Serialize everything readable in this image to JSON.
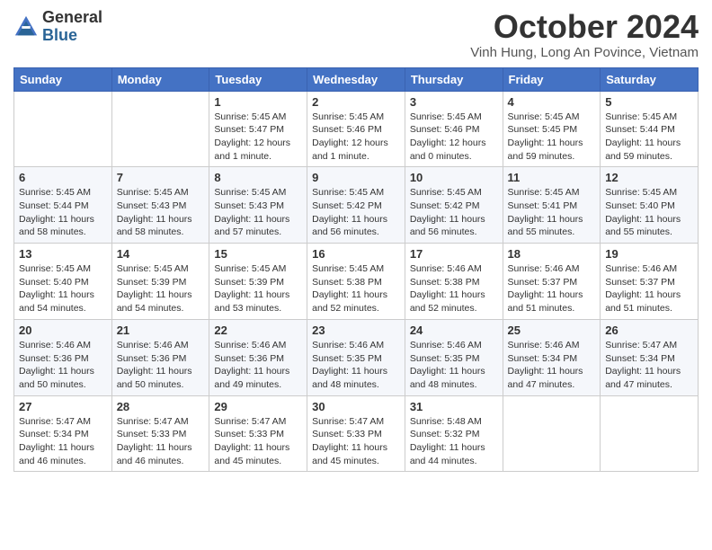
{
  "logo": {
    "general": "General",
    "blue": "Blue"
  },
  "header": {
    "month": "October 2024",
    "location": "Vinh Hung, Long An Povince, Vietnam"
  },
  "days_of_week": [
    "Sunday",
    "Monday",
    "Tuesday",
    "Wednesday",
    "Thursday",
    "Friday",
    "Saturday"
  ],
  "weeks": [
    [
      {
        "day": "",
        "info": ""
      },
      {
        "day": "",
        "info": ""
      },
      {
        "day": "1",
        "info": "Sunrise: 5:45 AM\nSunset: 5:47 PM\nDaylight: 12 hours and 1 minute."
      },
      {
        "day": "2",
        "info": "Sunrise: 5:45 AM\nSunset: 5:46 PM\nDaylight: 12 hours and 1 minute."
      },
      {
        "day": "3",
        "info": "Sunrise: 5:45 AM\nSunset: 5:46 PM\nDaylight: 12 hours and 0 minutes."
      },
      {
        "day": "4",
        "info": "Sunrise: 5:45 AM\nSunset: 5:45 PM\nDaylight: 11 hours and 59 minutes."
      },
      {
        "day": "5",
        "info": "Sunrise: 5:45 AM\nSunset: 5:44 PM\nDaylight: 11 hours and 59 minutes."
      }
    ],
    [
      {
        "day": "6",
        "info": "Sunrise: 5:45 AM\nSunset: 5:44 PM\nDaylight: 11 hours and 58 minutes."
      },
      {
        "day": "7",
        "info": "Sunrise: 5:45 AM\nSunset: 5:43 PM\nDaylight: 11 hours and 58 minutes."
      },
      {
        "day": "8",
        "info": "Sunrise: 5:45 AM\nSunset: 5:43 PM\nDaylight: 11 hours and 57 minutes."
      },
      {
        "day": "9",
        "info": "Sunrise: 5:45 AM\nSunset: 5:42 PM\nDaylight: 11 hours and 56 minutes."
      },
      {
        "day": "10",
        "info": "Sunrise: 5:45 AM\nSunset: 5:42 PM\nDaylight: 11 hours and 56 minutes."
      },
      {
        "day": "11",
        "info": "Sunrise: 5:45 AM\nSunset: 5:41 PM\nDaylight: 11 hours and 55 minutes."
      },
      {
        "day": "12",
        "info": "Sunrise: 5:45 AM\nSunset: 5:40 PM\nDaylight: 11 hours and 55 minutes."
      }
    ],
    [
      {
        "day": "13",
        "info": "Sunrise: 5:45 AM\nSunset: 5:40 PM\nDaylight: 11 hours and 54 minutes."
      },
      {
        "day": "14",
        "info": "Sunrise: 5:45 AM\nSunset: 5:39 PM\nDaylight: 11 hours and 54 minutes."
      },
      {
        "day": "15",
        "info": "Sunrise: 5:45 AM\nSunset: 5:39 PM\nDaylight: 11 hours and 53 minutes."
      },
      {
        "day": "16",
        "info": "Sunrise: 5:45 AM\nSunset: 5:38 PM\nDaylight: 11 hours and 52 minutes."
      },
      {
        "day": "17",
        "info": "Sunrise: 5:46 AM\nSunset: 5:38 PM\nDaylight: 11 hours and 52 minutes."
      },
      {
        "day": "18",
        "info": "Sunrise: 5:46 AM\nSunset: 5:37 PM\nDaylight: 11 hours and 51 minutes."
      },
      {
        "day": "19",
        "info": "Sunrise: 5:46 AM\nSunset: 5:37 PM\nDaylight: 11 hours and 51 minutes."
      }
    ],
    [
      {
        "day": "20",
        "info": "Sunrise: 5:46 AM\nSunset: 5:36 PM\nDaylight: 11 hours and 50 minutes."
      },
      {
        "day": "21",
        "info": "Sunrise: 5:46 AM\nSunset: 5:36 PM\nDaylight: 11 hours and 50 minutes."
      },
      {
        "day": "22",
        "info": "Sunrise: 5:46 AM\nSunset: 5:36 PM\nDaylight: 11 hours and 49 minutes."
      },
      {
        "day": "23",
        "info": "Sunrise: 5:46 AM\nSunset: 5:35 PM\nDaylight: 11 hours and 48 minutes."
      },
      {
        "day": "24",
        "info": "Sunrise: 5:46 AM\nSunset: 5:35 PM\nDaylight: 11 hours and 48 minutes."
      },
      {
        "day": "25",
        "info": "Sunrise: 5:46 AM\nSunset: 5:34 PM\nDaylight: 11 hours and 47 minutes."
      },
      {
        "day": "26",
        "info": "Sunrise: 5:47 AM\nSunset: 5:34 PM\nDaylight: 11 hours and 47 minutes."
      }
    ],
    [
      {
        "day": "27",
        "info": "Sunrise: 5:47 AM\nSunset: 5:34 PM\nDaylight: 11 hours and 46 minutes."
      },
      {
        "day": "28",
        "info": "Sunrise: 5:47 AM\nSunset: 5:33 PM\nDaylight: 11 hours and 46 minutes."
      },
      {
        "day": "29",
        "info": "Sunrise: 5:47 AM\nSunset: 5:33 PM\nDaylight: 11 hours and 45 minutes."
      },
      {
        "day": "30",
        "info": "Sunrise: 5:47 AM\nSunset: 5:33 PM\nDaylight: 11 hours and 45 minutes."
      },
      {
        "day": "31",
        "info": "Sunrise: 5:48 AM\nSunset: 5:32 PM\nDaylight: 11 hours and 44 minutes."
      },
      {
        "day": "",
        "info": ""
      },
      {
        "day": "",
        "info": ""
      }
    ]
  ]
}
